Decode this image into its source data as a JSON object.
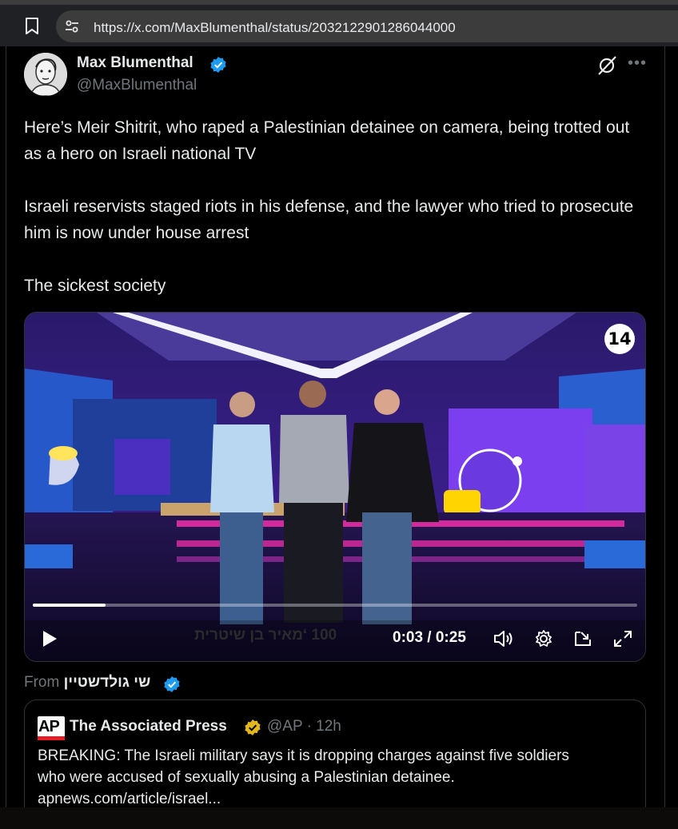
{
  "browser": {
    "url": "https://x.com/MaxBlumenthal/status/2032122901286044000"
  },
  "tweet": {
    "author_name": "Max Blumenthal",
    "author_handle": "@MaxBlumenthal",
    "paragraphs": [
      "Here’s Meir Shitrit, who raped a Palestinian detainee on camera, being trotted out as a hero on Israeli national TV",
      "Israeli reservists staged riots in his defense, and the lawyer who tried to prosecute him is now under house arrest",
      "The sickest society"
    ]
  },
  "video": {
    "channel_logo": "14",
    "lower_third": "100 ‘מאיר בן שיטרית",
    "time_display": "0:03 / 0:25",
    "progress": 0.12
  },
  "attribution": {
    "from_label": "From",
    "from_name": "שי גולדשטיין"
  },
  "quote": {
    "logo_text": "AP",
    "author_name": "The Associated Press",
    "meta": "@AP · 12h",
    "text_line1": "BREAKING: The Israeli military says it is dropping charges against five soldiers",
    "text_line2": "who were accused of sexually abusing a Palestinian detainee.",
    "text_line3": "apnews.com/article/israel..."
  },
  "colors": {
    "verified_blue": "#1d9bf0",
    "verified_gold": "#e2b719",
    "ap_red": "#e51c23"
  }
}
